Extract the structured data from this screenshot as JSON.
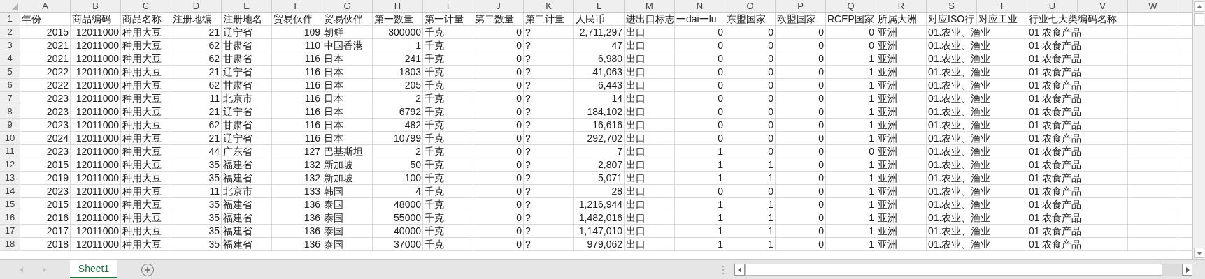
{
  "columns": [
    {
      "letter": "A",
      "kind": "number"
    },
    {
      "letter": "B",
      "kind": "number"
    },
    {
      "letter": "C",
      "kind": "text"
    },
    {
      "letter": "D",
      "kind": "number"
    },
    {
      "letter": "E",
      "kind": "text"
    },
    {
      "letter": "F",
      "kind": "number"
    },
    {
      "letter": "G",
      "kind": "text"
    },
    {
      "letter": "H",
      "kind": "number"
    },
    {
      "letter": "I",
      "kind": "text"
    },
    {
      "letter": "J",
      "kind": "number"
    },
    {
      "letter": "K",
      "kind": "text"
    },
    {
      "letter": "L",
      "kind": "number"
    },
    {
      "letter": "M",
      "kind": "text"
    },
    {
      "letter": "N",
      "kind": "number"
    },
    {
      "letter": "O",
      "kind": "number"
    },
    {
      "letter": "P",
      "kind": "number"
    },
    {
      "letter": "Q",
      "kind": "number"
    },
    {
      "letter": "R",
      "kind": "text"
    },
    {
      "letter": "S",
      "kind": "text"
    },
    {
      "letter": "T"
    },
    {
      "letter": "U",
      "kind": "text"
    },
    {
      "letter": "V"
    },
    {
      "letter": "W"
    }
  ],
  "header_row": {
    "number": "1",
    "cells": [
      "年份",
      "商品编码",
      "商品名称",
      "注册地编",
      "注册地名",
      "贸易伙伴",
      "贸易伙伴",
      "第一数量",
      "第一计量",
      "第二数量",
      "第二计量",
      "人民币",
      "进出口标志",
      "一dai一lu",
      "东盟国家",
      "欧盟国家",
      "RCEP国家",
      "所属大洲",
      "对应ISO行",
      "对应工业",
      "行业七大类编码名称"
    ]
  },
  "rows": [
    {
      "number": "2",
      "cells": [
        "2015",
        "12011000",
        "种用大豆",
        "21",
        "辽宁省",
        "109",
        "朝鲜",
        "300000",
        "千克",
        "0",
        "?",
        "2,711,297",
        "出口",
        "0",
        "0",
        "0",
        "0",
        "亚洲",
        "01.农业、渔业",
        null,
        "01 农食产品"
      ]
    },
    {
      "number": "3",
      "cells": [
        "2021",
        "12011000",
        "种用大豆",
        "62",
        "甘肃省",
        "110",
        "中国香港",
        "1",
        "千克",
        "0",
        "?",
        "47",
        "出口",
        "0",
        "0",
        "0",
        "0",
        "亚洲",
        "01.农业、渔业",
        null,
        "01 农食产品"
      ]
    },
    {
      "number": "4",
      "cells": [
        "2021",
        "12011000",
        "种用大豆",
        "62",
        "甘肃省",
        "116",
        "日本",
        "241",
        "千克",
        "0",
        "?",
        "6,980",
        "出口",
        "0",
        "0",
        "0",
        "1",
        "亚洲",
        "01.农业、渔业",
        null,
        "01 农食产品"
      ]
    },
    {
      "number": "5",
      "cells": [
        "2022",
        "12011000",
        "种用大豆",
        "21",
        "辽宁省",
        "116",
        "日本",
        "1803",
        "千克",
        "0",
        "?",
        "41,063",
        "出口",
        "0",
        "0",
        "0",
        "1",
        "亚洲",
        "01.农业、渔业",
        null,
        "01 农食产品"
      ]
    },
    {
      "number": "6",
      "cells": [
        "2022",
        "12011000",
        "种用大豆",
        "62",
        "甘肃省",
        "116",
        "日本",
        "205",
        "千克",
        "0",
        "?",
        "6,443",
        "出口",
        "0",
        "0",
        "0",
        "1",
        "亚洲",
        "01.农业、渔业",
        null,
        "01 农食产品"
      ]
    },
    {
      "number": "7",
      "cells": [
        "2023",
        "12011000",
        "种用大豆",
        "11",
        "北京市",
        "116",
        "日本",
        "2",
        "千克",
        "0",
        "?",
        "14",
        "出口",
        "0",
        "0",
        "0",
        "1",
        "亚洲",
        "01.农业、渔业",
        null,
        "01 农食产品"
      ]
    },
    {
      "number": "8",
      "cells": [
        "2023",
        "12011000",
        "种用大豆",
        "21",
        "辽宁省",
        "116",
        "日本",
        "6792",
        "千克",
        "0",
        "?",
        "184,102",
        "出口",
        "0",
        "0",
        "0",
        "1",
        "亚洲",
        "01.农业、渔业",
        null,
        "01 农食产品"
      ]
    },
    {
      "number": "9",
      "cells": [
        "2023",
        "12011000",
        "种用大豆",
        "62",
        "甘肃省",
        "116",
        "日本",
        "482",
        "千克",
        "0",
        "?",
        "16,616",
        "出口",
        "0",
        "0",
        "0",
        "1",
        "亚洲",
        "01.农业、渔业",
        null,
        "01 农食产品"
      ]
    },
    {
      "number": "10",
      "cells": [
        "2024",
        "12011000",
        "种用大豆",
        "21",
        "辽宁省",
        "116",
        "日本",
        "10799",
        "千克",
        "0",
        "?",
        "292,702",
        "出口",
        "0",
        "0",
        "0",
        "1",
        "亚洲",
        "01.农业、渔业",
        null,
        "01 农食产品"
      ]
    },
    {
      "number": "11",
      "cells": [
        "2023",
        "12011000",
        "种用大豆",
        "44",
        "广东省",
        "127",
        "巴基斯坦",
        "2",
        "千克",
        "0",
        "?",
        "7",
        "出口",
        "1",
        "0",
        "0",
        "0",
        "亚洲",
        "01.农业、渔业",
        null,
        "01 农食产品"
      ]
    },
    {
      "number": "12",
      "cells": [
        "2015",
        "12011000",
        "种用大豆",
        "35",
        "福建省",
        "132",
        "新加坡",
        "50",
        "千克",
        "0",
        "?",
        "2,807",
        "出口",
        "1",
        "1",
        "0",
        "1",
        "亚洲",
        "01.农业、渔业",
        null,
        "01 农食产品"
      ]
    },
    {
      "number": "13",
      "cells": [
        "2019",
        "12011000",
        "种用大豆",
        "35",
        "福建省",
        "132",
        "新加坡",
        "100",
        "千克",
        "0",
        "?",
        "5,071",
        "出口",
        "1",
        "1",
        "0",
        "1",
        "亚洲",
        "01.农业、渔业",
        null,
        "01 农食产品"
      ]
    },
    {
      "number": "14",
      "cells": [
        "2023",
        "12011000",
        "种用大豆",
        "11",
        "北京市",
        "133",
        "韩国",
        "4",
        "千克",
        "0",
        "?",
        "28",
        "出口",
        "0",
        "0",
        "0",
        "1",
        "亚洲",
        "01.农业、渔业",
        null,
        "01 农食产品"
      ]
    },
    {
      "number": "15",
      "cells": [
        "2015",
        "12011000",
        "种用大豆",
        "35",
        "福建省",
        "136",
        "泰国",
        "48000",
        "千克",
        "0",
        "?",
        "1,216,944",
        "出口",
        "1",
        "1",
        "0",
        "1",
        "亚洲",
        "01.农业、渔业",
        null,
        "01 农食产品"
      ]
    },
    {
      "number": "16",
      "cells": [
        "2016",
        "12011000",
        "种用大豆",
        "35",
        "福建省",
        "136",
        "泰国",
        "55000",
        "千克",
        "0",
        "?",
        "1,482,016",
        "出口",
        "1",
        "1",
        "0",
        "1",
        "亚洲",
        "01.农业、渔业",
        null,
        "01 农食产品"
      ]
    },
    {
      "number": "17",
      "cells": [
        "2017",
        "12011000",
        "种用大豆",
        "35",
        "福建省",
        "136",
        "泰国",
        "40000",
        "千克",
        "0",
        "?",
        "1,147,010",
        "出口",
        "1",
        "1",
        "0",
        "1",
        "亚洲",
        "01.农业、渔业",
        null,
        "01 农食产品"
      ]
    },
    {
      "number": "18",
      "cells": [
        "2018",
        "12011000",
        "种用大豆",
        "35",
        "福建省",
        "136",
        "泰国",
        "37000",
        "千克",
        "0",
        "?",
        "979,062",
        "出口",
        "1",
        "1",
        "0",
        "1",
        "亚洲",
        "01.农业、渔业",
        null,
        "01 农食产品"
      ]
    }
  ],
  "sheet_tabs": [
    {
      "label": "Sheet1",
      "selected": true
    }
  ]
}
